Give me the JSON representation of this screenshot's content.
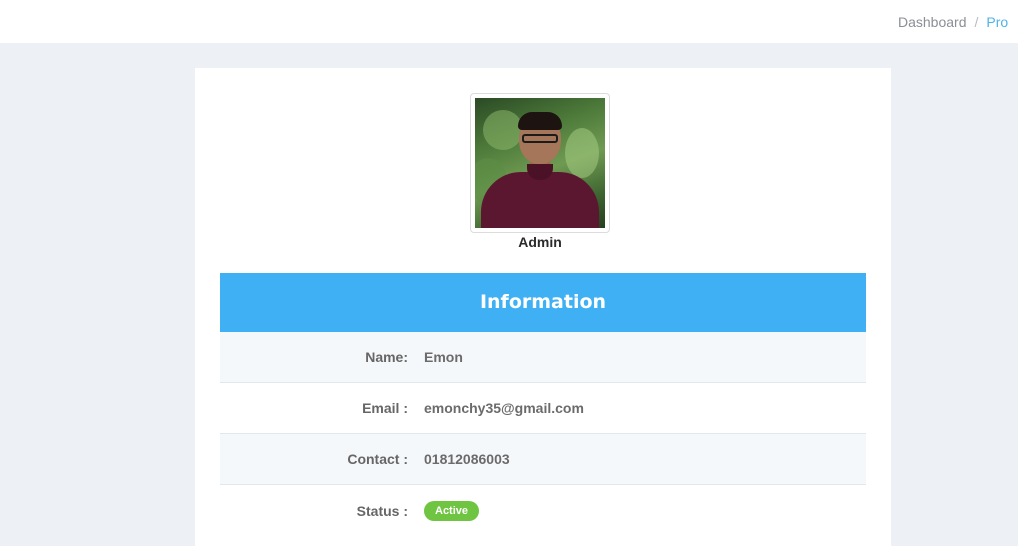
{
  "breadcrumb": {
    "items": [
      "Dashboard",
      "Pro"
    ]
  },
  "profile": {
    "role": "Admin",
    "avatar_alt": "profile photo"
  },
  "info": {
    "title": "Information",
    "rows": [
      {
        "label": "Name:",
        "value": "Emon"
      },
      {
        "label": "Email :",
        "value": "emonchy35@gmail.com"
      },
      {
        "label": "Contact :",
        "value": "01812086003"
      },
      {
        "label": "Status :",
        "value": "Active"
      }
    ]
  },
  "colors": {
    "header": "#3fb0f4",
    "status_active": "#6fc442",
    "breadcrumb_active": "#4fb3e8"
  }
}
